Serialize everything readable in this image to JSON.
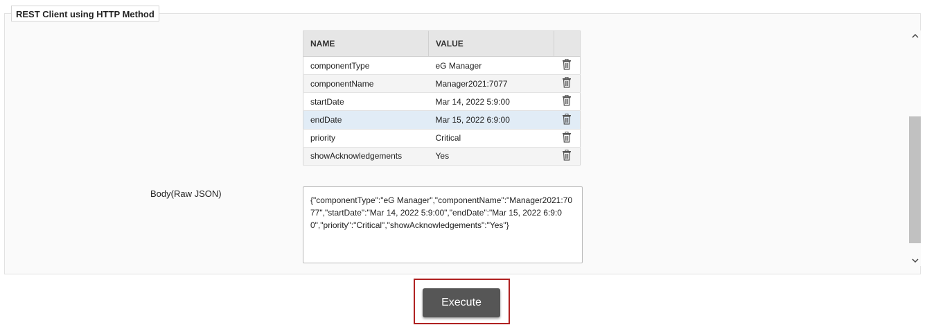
{
  "panel": {
    "title": "REST Client using HTTP Method"
  },
  "params_table": {
    "headers": [
      "NAME",
      "VALUE",
      ""
    ],
    "rows": [
      {
        "name": "componentType",
        "value": "eG Manager"
      },
      {
        "name": "componentName",
        "value": "Manager2021:7077"
      },
      {
        "name": "startDate",
        "value": "Mar 14, 2022 5:9:00"
      },
      {
        "name": "endDate",
        "value": "Mar 15, 2022 6:9:00"
      },
      {
        "name": "priority",
        "value": "Critical"
      },
      {
        "name": "showAcknowledgements",
        "value": "Yes"
      }
    ],
    "delete_icon": "trash-icon"
  },
  "body": {
    "label": "Body(Raw JSON)",
    "value": "{\"componentType\":\"eG Manager\",\"componentName\":\"Manager2021:7077\",\"startDate\":\"Mar 14, 2022 5:9:00\",\"endDate\":\"Mar 15, 2022 6:9:00\",\"priority\":\"Critical\",\"showAcknowledgements\":\"Yes\"}"
  },
  "actions": {
    "execute_label": "Execute",
    "highlight_color": "#b02121"
  },
  "colors": {
    "header_bg": "#e6e6e6",
    "selected_row_bg": "#e1ecf6",
    "button_bg": "#565656"
  }
}
